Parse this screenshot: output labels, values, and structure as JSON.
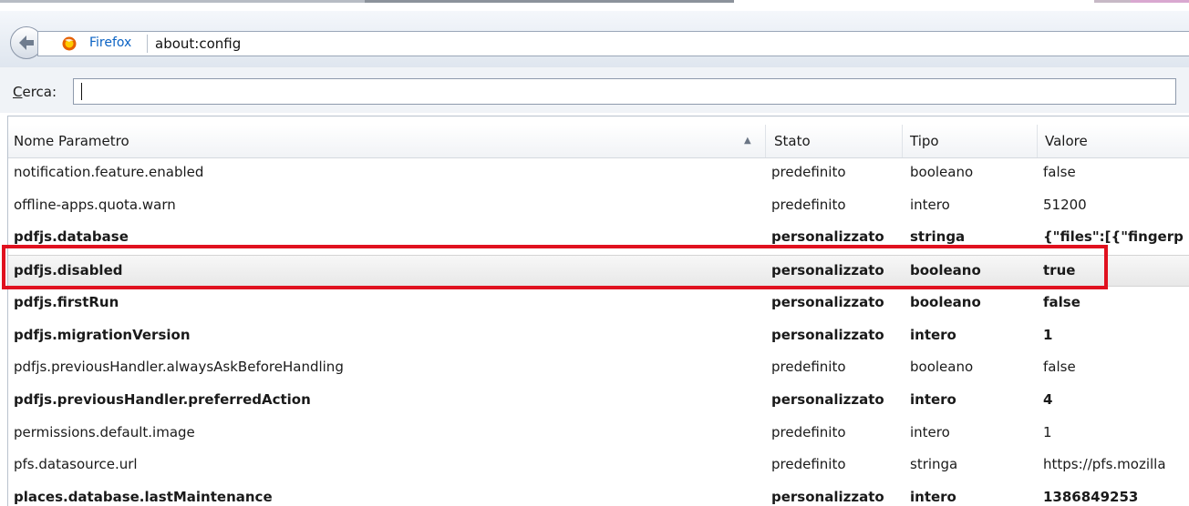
{
  "colors": {
    "highlight": "#e0111f",
    "link": "#0b63c4"
  },
  "navbar": {
    "back_icon": "back-arrow-icon",
    "browser_icon": "firefox-icon",
    "identity_label": "Firefox",
    "url": "about:config"
  },
  "search": {
    "label_accesskey": "C",
    "label_rest": "erca:",
    "value": ""
  },
  "table": {
    "headers": {
      "name": "Nome Parametro",
      "stato": "Stato",
      "tipo": "Tipo",
      "valore": "Valore"
    },
    "sorted_column": "name",
    "rows": [
      {
        "name": "notification.feature.enabled",
        "stato": "predefinito",
        "tipo": "booleano",
        "valore": "false",
        "bold": false
      },
      {
        "name": "offline-apps.quota.warn",
        "stato": "predefinito",
        "tipo": "intero",
        "valore": "51200",
        "bold": false
      },
      {
        "name": "pdfjs.database",
        "stato": "personalizzato",
        "tipo": "stringa",
        "valore": "{\"files\":[{\"fingerp",
        "bold": true
      },
      {
        "name": "pdfjs.disabled",
        "stato": "personalizzato",
        "tipo": "booleano",
        "valore": "true",
        "bold": true,
        "selected": true
      },
      {
        "name": "pdfjs.firstRun",
        "stato": "personalizzato",
        "tipo": "booleano",
        "valore": "false",
        "bold": true
      },
      {
        "name": "pdfjs.migrationVersion",
        "stato": "personalizzato",
        "tipo": "intero",
        "valore": "1",
        "bold": true
      },
      {
        "name": "pdfjs.previousHandler.alwaysAskBeforeHandling",
        "stato": "predefinito",
        "tipo": "booleano",
        "valore": "false",
        "bold": false
      },
      {
        "name": "pdfjs.previousHandler.preferredAction",
        "stato": "personalizzato",
        "tipo": "intero",
        "valore": "4",
        "bold": true
      },
      {
        "name": "permissions.default.image",
        "stato": "predefinito",
        "tipo": "intero",
        "valore": "1",
        "bold": false
      },
      {
        "name": "pfs.datasource.url",
        "stato": "predefinito",
        "tipo": "stringa",
        "valore": "https://pfs.mozilla",
        "bold": false
      },
      {
        "name": "places.database.lastMaintenance",
        "stato": "personalizzato",
        "tipo": "intero",
        "valore": "1386849253",
        "bold": true
      }
    ]
  }
}
